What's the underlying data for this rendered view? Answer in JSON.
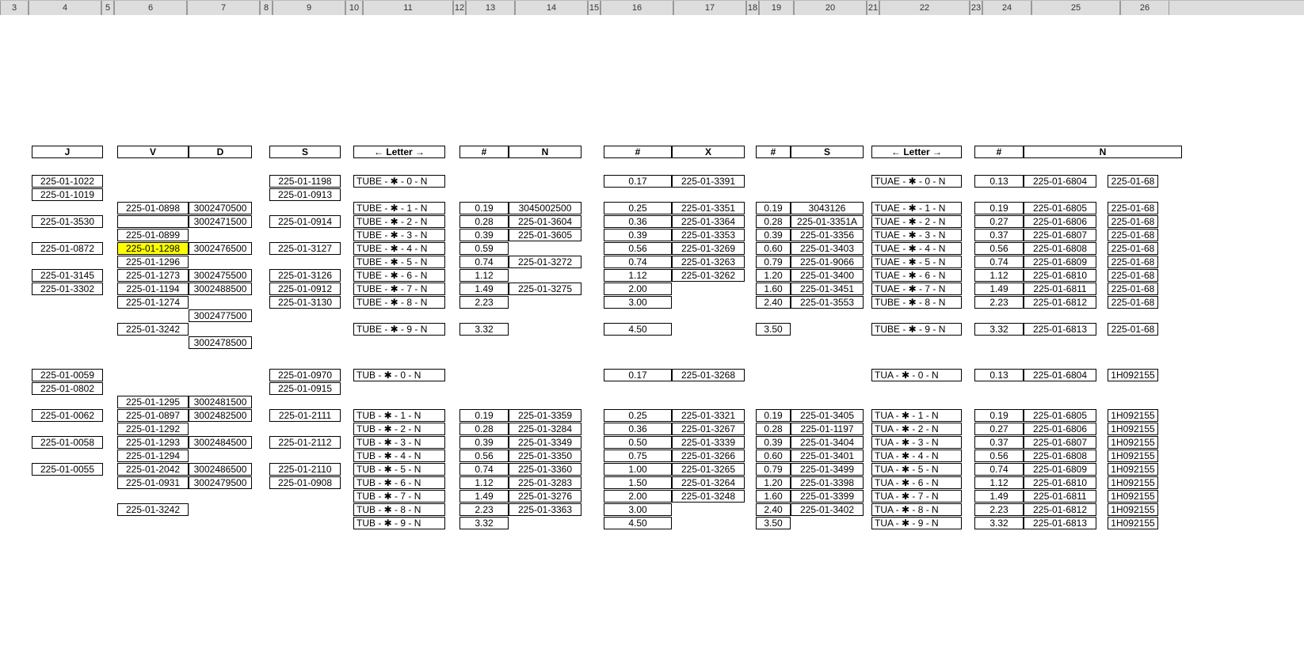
{
  "ruler": [
    "3",
    "4",
    "5",
    "6",
    "7",
    "8",
    "9",
    "10",
    "11",
    "12",
    "13",
    "14",
    "15",
    "16",
    "17",
    "18",
    "19",
    "20",
    "21",
    "22",
    "23",
    "24",
    "25",
    "26"
  ],
  "hdr": {
    "J": "J",
    "V": "V",
    "D": "D",
    "S": "S",
    "L1": "← Letter →",
    "N1a": "#",
    "N1b": "N",
    "X1a": "#",
    "X1b": "X",
    "S1a": "#",
    "S1b": "S",
    "L2": "← Letter →",
    "N2a": "#",
    "N2b": "N"
  },
  "J": {
    "r0": "225-01-1022",
    "r1": "225-01-1019",
    "r3": "225-01-3530",
    "r5": "225-01-0872",
    "r7": "225-01-3145",
    "r8": "225-01-3302",
    "r13": "225-01-0059",
    "r14": "225-01-0802",
    "r16": "225-01-0062",
    "r18": "225-01-0058",
    "r20": "225-01-0055"
  },
  "V": {
    "r2": "225-01-0898",
    "r3": "",
    "r4": "225-01-0899",
    "r5": "225-01-1298",
    "r6": "225-01-1296",
    "r7": "225-01-1273",
    "r8": "225-01-1194",
    "r9": "225-01-1274",
    "r11": "225-01-3242",
    "r15": "225-01-1295",
    "r16": "225-01-0897",
    "r17": "225-01-1292",
    "r18": "225-01-1293",
    "r19": "225-01-1294",
    "r20": "225-01-2042",
    "r21": "225-01-0931",
    "r23": "225-01-3242"
  },
  "D": {
    "r2": "3002470500",
    "r3": "3002471500",
    "r5": "3002476500",
    "r7": "3002475500",
    "r8": "3002488500",
    "r10": "3002477500",
    "r12": "3002478500",
    "r15": "3002481500",
    "r16": "3002482500",
    "r18": "3002484500",
    "r20": "3002486500",
    "r21": "3002479500"
  },
  "S": {
    "r0": "225-01-1198",
    "r1": "225-01-0913",
    "r3": "225-01-0914",
    "r5": "225-01-3127",
    "r7": "225-01-3126",
    "r8": "225-01-0912",
    "r9": "225-01-3130",
    "r13": "225-01-0970",
    "r14": "225-01-0915",
    "r16": "225-01-2111",
    "r18": "225-01-2112",
    "r20": "225-01-2110",
    "r21": "225-01-0908"
  },
  "L1": {
    "r0": "TUBE - ✱ - 0 - N",
    "r2": "TUBE - ✱ - 1 - N",
    "r3": "TUBE - ✱ - 2 - N",
    "r4": "TUBE - ✱ - 3 - N",
    "r5": "TUBE - ✱ - 4 - N",
    "r6": "TUBE - ✱ - 5 - N",
    "r7": "TUBE - ✱ - 6 - N",
    "r8": "TUBE - ✱ - 7 - N",
    "r9": "TUBE - ✱ - 8 - N",
    "r11": "TUBE - ✱ - 9 - N",
    "r13": "TUB  - ✱ - 0 - N",
    "r16": "TUB  - ✱ - 1 - N",
    "r17": "TUB  - ✱ - 2 - N",
    "r18": "TUB  - ✱ - 3 - N",
    "r19": "TUB  - ✱ - 4 - N",
    "r20": "TUB  - ✱ - 5 - N",
    "r21": "TUB  - ✱ - 6 - N",
    "r22": "TUB  - ✱ - 7 - N",
    "r23": "TUB  - ✱ - 8 - N",
    "r24": "TUB  - ✱ - 9 - N"
  },
  "Na": {
    "r2": "0.19",
    "r3": "0.28",
    "r4": "0.39",
    "r5": "0.59",
    "r6": "0.74",
    "r7": "1.12",
    "r8": "1.49",
    "r9": "2.23",
    "r11": "3.32",
    "r16": "0.19",
    "r17": "0.28",
    "r18": "0.39",
    "r19": "0.56",
    "r20": "0.74",
    "r21": "1.12",
    "r22": "1.49",
    "r23": "2.23",
    "r24": "3.32"
  },
  "Nb": {
    "r2": "3045002500",
    "r3": "225-01-3604",
    "r4": "225-01-3605",
    "r6": "225-01-3272",
    "r8": "225-01-3275",
    "r16": "225-01-3359",
    "r17": "225-01-3284",
    "r18": "225-01-3349",
    "r19": "225-01-3350",
    "r20": "225-01-3360",
    "r21": "225-01-3283",
    "r22": "225-01-3276",
    "r23": "225-01-3363"
  },
  "Xa": {
    "r0": "0.17",
    "r2": "0.25",
    "r3": "0.36",
    "r4": "0.39",
    "r5": "0.56",
    "r6": "0.74",
    "r7": "1.12",
    "r8": "2.00",
    "r9": "3.00",
    "r11": "4.50",
    "r13": "0.17",
    "r16": "0.25",
    "r17": "0.36",
    "r18": "0.50",
    "r19": "0.75",
    "r20": "1.00",
    "r21": "1.50",
    "r22": "2.00",
    "r23": "3.00",
    "r24": "4.50"
  },
  "Xb": {
    "r0": "225-01-3391",
    "r2": "225-01-3351",
    "r3": "225-01-3364",
    "r4": "225-01-3353",
    "r5": "225-01-3269",
    "r6": "225-01-3263",
    "r7": "225-01-3262",
    "r13": "225-01-3268",
    "r16": "225-01-3321",
    "r17": "225-01-3267",
    "r18": "225-01-3339",
    "r19": "225-01-3266",
    "r20": "225-01-3265",
    "r21": "225-01-3264",
    "r22": "225-01-3248"
  },
  "Sa": {
    "r2": "0.19",
    "r3": "0.28",
    "r4": "0.39",
    "r5": "0.60",
    "r6": "0.79",
    "r7": "1.20",
    "r8": "1.60",
    "r9": "2.40",
    "r11": "3.50",
    "r16": "0.19",
    "r17": "0.28",
    "r18": "0.39",
    "r19": "0.60",
    "r20": "0.79",
    "r21": "1.20",
    "r22": "1.60",
    "r23": "2.40",
    "r24": "3.50"
  },
  "Sb": {
    "r2": "3043126",
    "r3": "225-01-3351A",
    "r4": "225-01-3356",
    "r5": "225-01-3403",
    "r6": "225-01-9066",
    "r7": "225-01-3400",
    "r8": "225-01-3451",
    "r9": "225-01-3553",
    "r16": "225-01-3405",
    "r17": "225-01-1197",
    "r18": "225-01-3404",
    "r19": "225-01-3401",
    "r20": "225-01-3499",
    "r21": "225-01-3398",
    "r22": "225-01-3399",
    "r23": "225-01-3402"
  },
  "L2": {
    "r0": "TUAE - ✱ - 0 - N",
    "r2": "TUAE - ✱ - 1 - N",
    "r3": "TUAE - ✱ - 2 - N",
    "r4": "TUAE - ✱ - 3 - N",
    "r5": "TUAE - ✱ - 4 - N",
    "r6": "TUAE - ✱ - 5 - N",
    "r7": "TUAE - ✱ - 6 - N",
    "r8": "TUAE - ✱ - 7 - N",
    "r9": "TUBE - ✱ - 8 - N",
    "r11": "TUBE - ✱ - 9 - N",
    "r13": "TUA  - ✱ - 0 - N",
    "r16": "TUA  - ✱ - 1 - N",
    "r17": "TUA  - ✱ - 2 - N",
    "r18": "TUA  - ✱ - 3 - N",
    "r19": "TUA  - ✱ - 4 - N",
    "r20": "TUA  - ✱ - 5 - N",
    "r21": "TUA  - ✱ - 6 - N",
    "r22": "TUA  - ✱ - 7 - N",
    "r23": "TUA - ✱ - 8 - N",
    "r24": "TUA - ✱ - 9 - N"
  },
  "N2a": {
    "r0": "0.13",
    "r2": "0.19",
    "r3": "0.27",
    "r4": "0.37",
    "r5": "0.56",
    "r6": "0.74",
    "r7": "1.12",
    "r8": "1.49",
    "r9": "2.23",
    "r11": "3.32",
    "r13": "0.13",
    "r16": "0.19",
    "r17": "0.27",
    "r18": "0.37",
    "r19": "0.56",
    "r20": "0.74",
    "r21": "1.12",
    "r22": "1.49",
    "r23": "2.23",
    "r24": "3.32"
  },
  "N2b": {
    "r0": "225-01-6804",
    "r2": "225-01-6805",
    "r3": "225-01-6806",
    "r4": "225-01-6807",
    "r5": "225-01-6808",
    "r6": "225-01-6809",
    "r7": "225-01-6810",
    "r8": "225-01-6811",
    "r9": "225-01-6812",
    "r11": "225-01-6813",
    "r13": "225-01-6804",
    "r16": "225-01-6805",
    "r17": "225-01-6806",
    "r18": "225-01-6807",
    "r19": "225-01-6808",
    "r20": "225-01-6809",
    "r21": "225-01-6810",
    "r22": "225-01-6811",
    "r23": "225-01-6812",
    "r24": "225-01-6813"
  },
  "N2c": {
    "r0": "225-01-68",
    "r2": "225-01-68",
    "r3": "225-01-68",
    "r4": "225-01-68",
    "r5": "225-01-68",
    "r6": "225-01-68",
    "r7": "225-01-68",
    "r8": "225-01-68",
    "r9": "225-01-68",
    "r11": "225-01-68",
    "r13": "1H092155",
    "r16": "1H092155",
    "r17": "1H092155",
    "r18": "1H092155",
    "r19": "1H092155",
    "r20": "1H092155",
    "r21": "1H092155",
    "r22": "1H092155",
    "r23": "1H092155",
    "r24": "1H092155"
  }
}
